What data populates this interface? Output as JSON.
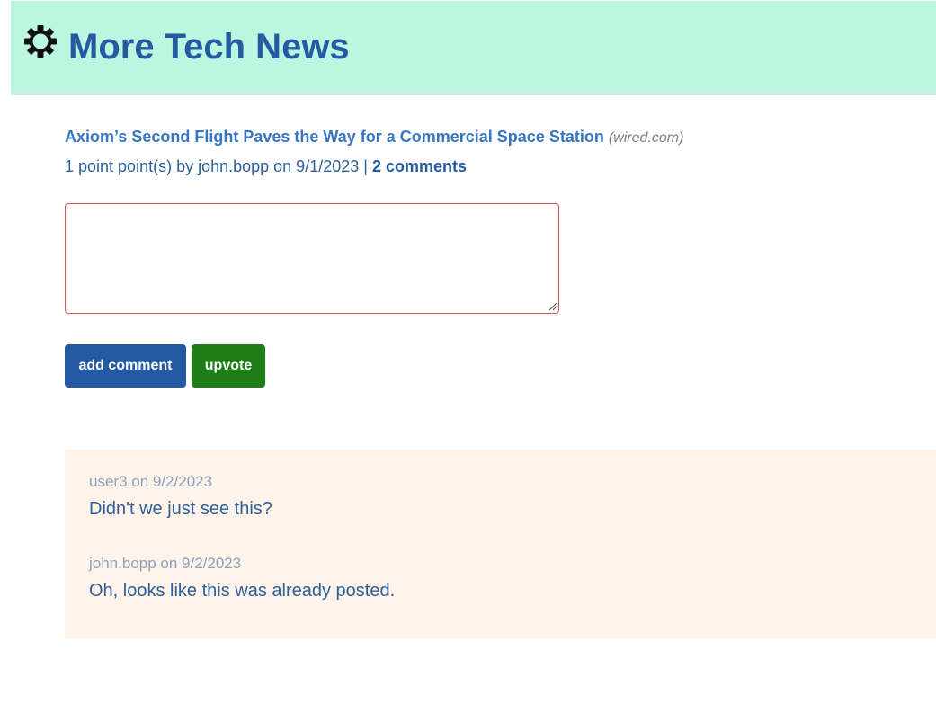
{
  "header": {
    "logo_icon": "gear-icon",
    "title": "More Tech News",
    "background_color": "#bbf6df",
    "title_color": "#245aa1"
  },
  "story": {
    "title": "Axiom’s Second Flight Paves the Way for a Commercial Space Station",
    "domain": "(wired.com)",
    "meta_text": "1 point point(s) by john.bopp on 9/1/2023 |",
    "comments_link": "2 comments"
  },
  "comment_form": {
    "textarea_value": "",
    "add_comment_label": "add comment",
    "upvote_label": "upvote",
    "add_comment_color": "#245aa1",
    "upvote_color": "#1e7d16"
  },
  "comments": [
    {
      "meta": "user3 on 9/2/2023",
      "text": "Didn't we just see this?"
    },
    {
      "meta": "john.bopp on 9/2/2023",
      "text": "Oh, looks like this was already posted."
    }
  ]
}
